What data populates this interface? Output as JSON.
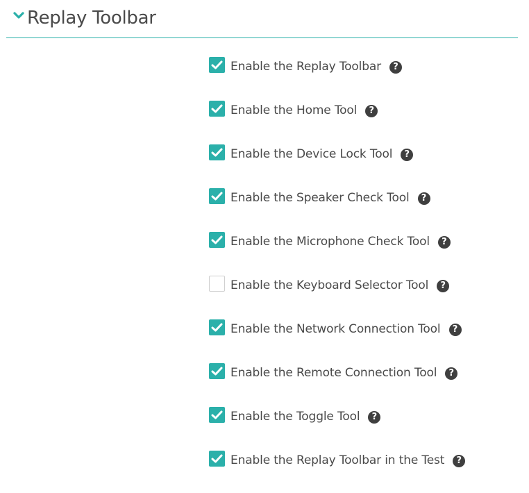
{
  "section": {
    "title": "Replay Toolbar",
    "expanded": true,
    "accent_color": "#2bb0aa"
  },
  "icons": {
    "help": "?"
  },
  "options": [
    {
      "label": "Enable the Replay Toolbar",
      "checked": true
    },
    {
      "label": "Enable the Home Tool",
      "checked": true
    },
    {
      "label": "Enable the Device Lock Tool",
      "checked": true
    },
    {
      "label": "Enable the Speaker Check Tool",
      "checked": true
    },
    {
      "label": "Enable the Microphone Check Tool",
      "checked": true
    },
    {
      "label": "Enable the Keyboard Selector Tool",
      "checked": false
    },
    {
      "label": "Enable the Network Connection Tool",
      "checked": true
    },
    {
      "label": "Enable the Remote Connection Tool",
      "checked": true
    },
    {
      "label": "Enable the Toggle Tool",
      "checked": true
    },
    {
      "label": "Enable the Replay Toolbar in the Test",
      "checked": true
    }
  ]
}
